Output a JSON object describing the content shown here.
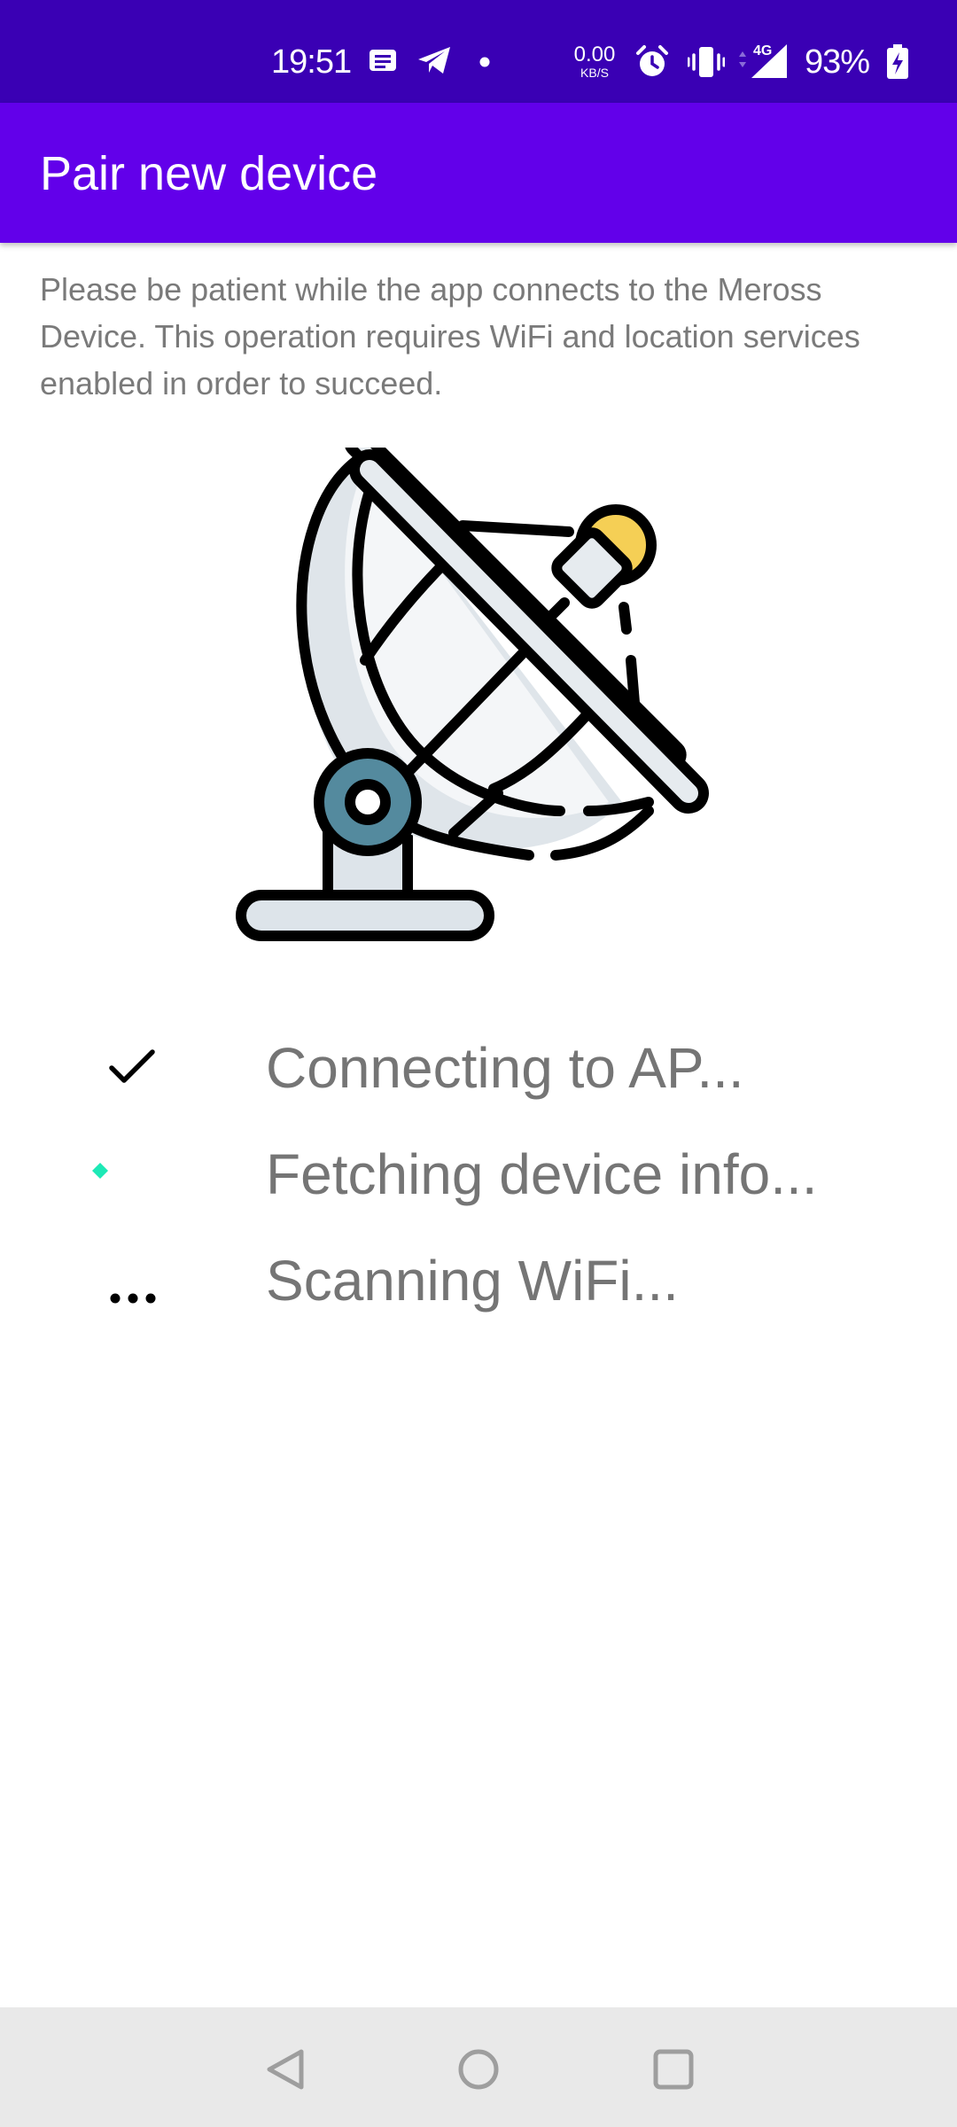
{
  "status_bar": {
    "time": "19:51",
    "notification_icons": [
      "message-icon",
      "telegram-icon",
      "dot-icon"
    ],
    "network_speed_value": "0.00",
    "network_speed_unit": "KB/S",
    "status_icons": [
      "alarm-icon",
      "vibrate-icon",
      "signal-4g-icon"
    ],
    "battery_percent": "93%",
    "battery_state": "charging"
  },
  "app_bar": {
    "title": "Pair new device",
    "color": "#6200ea"
  },
  "description": "Please be patient while the app connects to the Meross Device. This operation requires WiFi and location services enabled in order to succeed.",
  "illustration": {
    "icon": "satellite-dish-icon"
  },
  "steps": [
    {
      "label": "Connecting to AP...",
      "state": "done",
      "icon": "checkmark-icon"
    },
    {
      "label": "Fetching device info...",
      "state": "in-progress",
      "icon": "loading-spinner-icon",
      "accent": "#1de9b6"
    },
    {
      "label": "Scanning WiFi...",
      "state": "pending",
      "icon": "more-dots-icon"
    }
  ],
  "nav_bar": {
    "buttons": [
      "back-icon",
      "home-icon",
      "recents-icon"
    ]
  }
}
